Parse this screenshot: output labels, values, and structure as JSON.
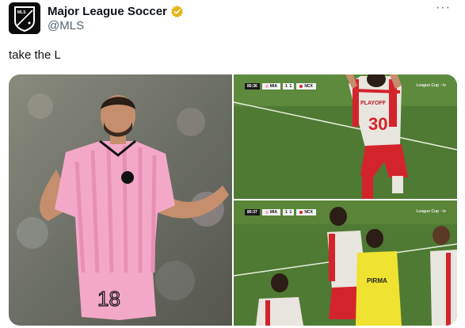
{
  "tweet": {
    "author": {
      "display_name": "Major League Soccer",
      "handle": "@MLS",
      "verified": true,
      "avatar_text": "MLS"
    },
    "text": "take the L",
    "more_label": "···",
    "media": [
      {
        "id": "photo-1",
        "description_icon": "player-shrug-photo",
        "jersey_number": "18"
      },
      {
        "id": "photo-2",
        "jersey_text": "PLAYOFF",
        "jersey_number": "30",
        "scorebug": {
          "time": "80:36",
          "home": "MIA",
          "home_score": "1",
          "away_score": "1",
          "away": "NCX"
        },
        "broadcaster": "League Cup  ·  tv"
      },
      {
        "id": "photo-3",
        "bib_text": "PIRMA",
        "scorebug": {
          "time": "80:37",
          "home": "MIA",
          "home_score": "1",
          "away_score": "1",
          "away": "NCX"
        },
        "broadcaster": "League Cup  ·  tv"
      }
    ]
  },
  "colors": {
    "mls_pink": "#f4a8c8",
    "pitch_green": "#4f7a33",
    "necaxa_red": "#d3242c",
    "verified_gold": "#e2b719"
  }
}
